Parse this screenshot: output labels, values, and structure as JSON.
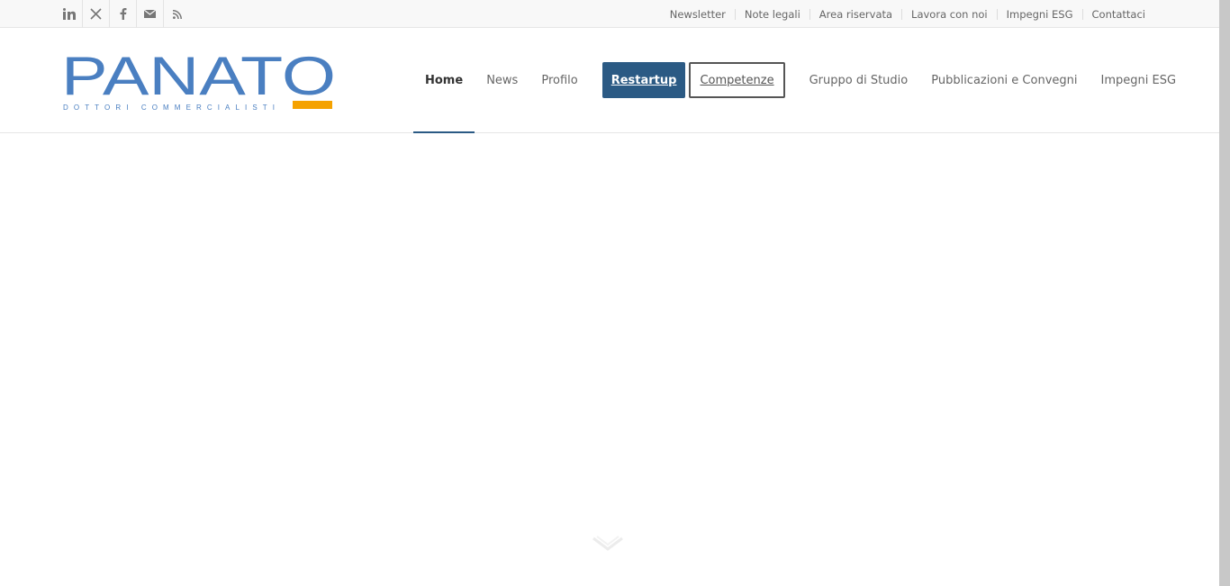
{
  "topbar": {
    "social_icons": [
      "linkedin-icon",
      "x-twitter-icon",
      "facebook-icon",
      "mail-icon",
      "rss-icon"
    ],
    "links": [
      "Newsletter",
      "Note legali",
      "Area riservata",
      "Lavora con noi",
      "Impegni ESG",
      "Contattaci"
    ]
  },
  "logo": {
    "wordmark": "PANATO",
    "tagline": "DOTTORI COMMERCIALISTI",
    "brand_color": "#4a7fc1",
    "accent_color": "#f5a200"
  },
  "nav": {
    "items": [
      "Home",
      "News",
      "Profilo"
    ],
    "button_primary": "Restartup",
    "button_outline": "Competenze",
    "items_after": [
      "Gruppo di Studio",
      "Pubblicazioni e Convegni",
      "Impegni ESG"
    ],
    "active": "Home",
    "accent_color": "#2b5a84"
  },
  "scroll_hint_icon": "chevron-double-down-icon"
}
